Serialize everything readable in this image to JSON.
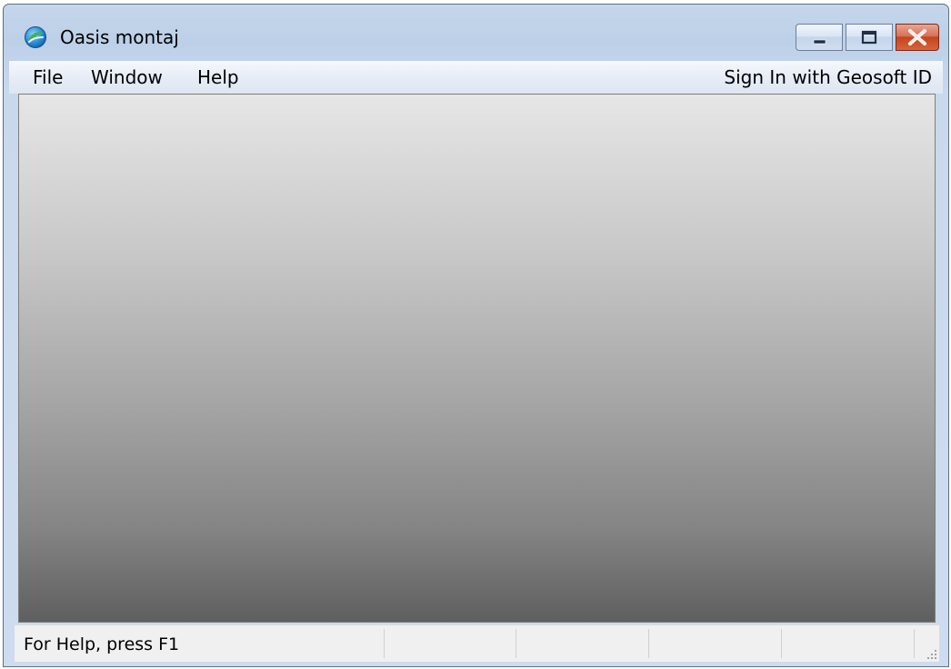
{
  "window": {
    "title": "Oasis montaj",
    "app_icon": "oasis-montaj-app-icon",
    "caption_buttons": {
      "minimize_icon": "minimize-icon",
      "maximize_icon": "maximize-icon",
      "close_icon": "close-icon"
    },
    "accent_close": "#c7472a",
    "frame_color": "#bcd0e8"
  },
  "menubar": {
    "items": [
      {
        "label": "File"
      },
      {
        "label": "Window"
      },
      {
        "label": "Help"
      }
    ],
    "sign_in_label": "Sign In with Geosoft ID"
  },
  "statusbar": {
    "help_text": "For Help, press F1",
    "grip_icon": "resize-grip-icon"
  }
}
